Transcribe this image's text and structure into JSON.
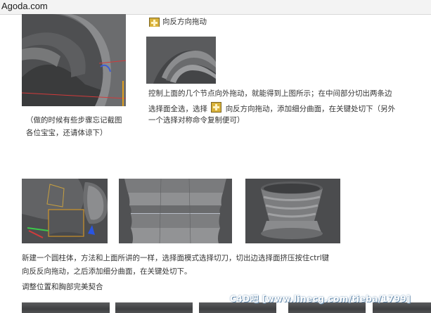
{
  "window": {
    "title": "Agoda.com"
  },
  "section1": {
    "caption_left": [
      "（做的时候有些步骤忘记截图",
      "各位宝宝，还请体谅下）"
    ],
    "top_instruction": "向反方向拖动",
    "paragraph_line1": "控制上面的几个节点向外拖动，就能得到上图所示；在中间部分切出两条边",
    "paragraph_line2_pre": "选择面全选，选择",
    "paragraph_line2_post": "向反方向拖动，添加细分曲面，在关键处切下（另外",
    "paragraph_line3": "一个选择对称命令复制便可）"
  },
  "section2": {
    "line1": "新建一个圆柱体，方法和上面所讲的一样，选择面模式选择切刀，切出边选择面挤压按住ctrl键",
    "line2": "向反反向拖动，之后添加细分曲面，在关键处切下。",
    "line3": "调整位置和胸部完美契合"
  },
  "watermark": "C4D吧 [www.linecg.com/tieba/1799]",
  "icons": {
    "move_tool": "move-tool-icon"
  }
}
